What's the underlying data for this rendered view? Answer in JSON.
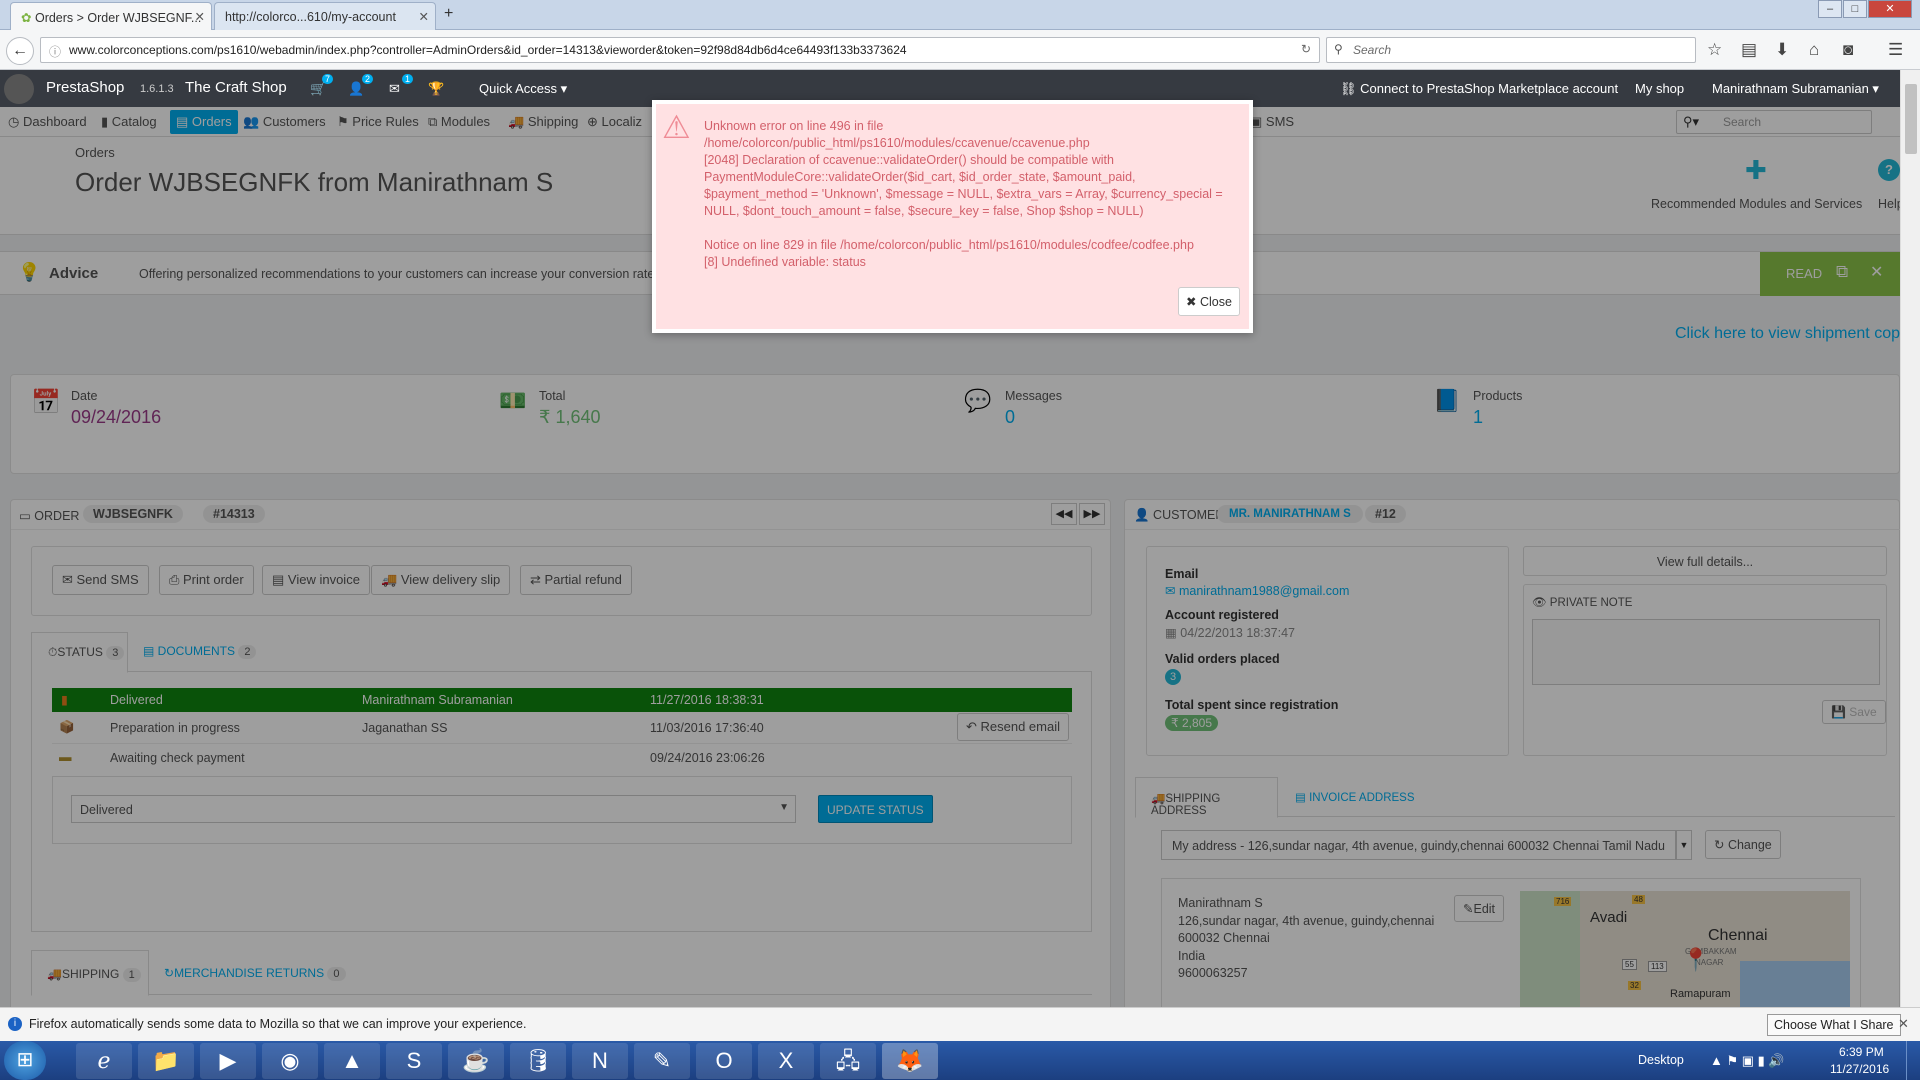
{
  "browser": {
    "tabs": [
      {
        "title": "Orders > Order WJBSEGNF...",
        "active": true
      },
      {
        "title": "http://colorco...610/my-account",
        "active": false
      }
    ],
    "url": "www.colorconceptions.com/ps1610/webadmin/index.php?controller=AdminOrders&id_order=14313&vieworder&token=92f98d84db6d4ce64493f133b3373624",
    "search_placeholder": "Search"
  },
  "header": {
    "brand": "PrestaShop",
    "version": "1.6.1.3",
    "shop_name": "The Craft Shop",
    "cart_count": "7",
    "customers_count": "2",
    "messages_count": "1",
    "quick_access": "Quick Access",
    "marketplace": "Connect to PrestaShop Marketplace account",
    "my_shop": "My shop",
    "user": "Manirathnam Subramanian"
  },
  "menu": {
    "items": [
      "Dashboard",
      "Catalog",
      "Orders",
      "Customers",
      "Price Rules",
      "Modules",
      "Shipping",
      "Localiz",
      "SMS"
    ],
    "search_placeholder": "Search"
  },
  "page": {
    "breadcrumb": "Orders",
    "title": "Order WJBSEGNFK from Manirathnam S",
    "recommended": "Recommended Modules and Services",
    "help": "Help"
  },
  "advice": {
    "label": "Advice",
    "text": "Offering personalized recommendations to your customers can increase your conversion rate",
    "read": "READ"
  },
  "shipment_link": "Click here to view shipment copy",
  "kpis": [
    {
      "label": "Date",
      "value": "09/24/2016"
    },
    {
      "label": "Total",
      "value": "₹ 1,640"
    },
    {
      "label": "Messages",
      "value": "0"
    },
    {
      "label": "Products",
      "value": "1"
    }
  ],
  "order": {
    "heading": "ORDER",
    "reference": "WJBSEGNFK",
    "id": "#14313",
    "actions": [
      "Send SMS",
      "Print order",
      "View invoice",
      "View delivery slip",
      "Partial refund"
    ],
    "tab_status": "STATUS",
    "tab_status_count": "3",
    "tab_documents": "DOCUMENTS",
    "tab_documents_count": "2",
    "history": [
      {
        "status": "Delivered",
        "employee": "Manirathnam Subramanian",
        "date": "11/27/2016 18:38:31"
      },
      {
        "status": "Preparation in progress",
        "employee": "Jaganathan SS",
        "date": "11/03/2016 17:36:40"
      },
      {
        "status": "Awaiting check payment",
        "employee": "",
        "date": "09/24/2016 23:06:26"
      }
    ],
    "resend_email": "Resend email",
    "status_select": "Delivered",
    "update_status": "UPDATE STATUS",
    "tab_shipping": "SHIPPING",
    "tab_shipping_count": "1",
    "tab_returns": "MERCHANDISE RETURNS",
    "tab_returns_count": "0"
  },
  "customer": {
    "heading": "CUSTOMER",
    "name": "MR. MANIRATHNAM S",
    "id": "#12",
    "view_details": "View full details...",
    "email_label": "Email",
    "email": "manirathnam1988@gmail.com",
    "registered_label": "Account registered",
    "registered": "04/22/2013 18:37:47",
    "valid_orders_label": "Valid orders placed",
    "valid_orders": "3",
    "total_spent_label": "Total spent since registration",
    "total_spent": "₹ 2,805",
    "private_note": "PRIVATE NOTE",
    "save": "Save",
    "tab_shipping_address": "SHIPPING ADDRESS",
    "tab_invoice_address": "INVOICE ADDRESS",
    "address_select": "My address - 126,sundar nagar, 4th avenue, guindy,chennai 600032 Chennai Tamil Nadu",
    "change": "Change",
    "edit": "Edit",
    "address_lines": [
      "Manirathnam S",
      "126,sundar nagar, 4th avenue, guindy,chennai",
      "600032 Chennai",
      "India",
      "9600063257"
    ],
    "map_labels": [
      "Avadi",
      "Chennai",
      "GAMBAKKAM",
      "NAGAR",
      "Ramapuram",
      "716",
      "48",
      "55",
      "113",
      "32"
    ]
  },
  "modal": {
    "line1": "Unknown error on line 496 in file /home/colorcon/public_html/ps1610/modules/ccavenue/ccavenue.php",
    "line2": "[2048] Declaration of ccavenue::validateOrder() should be compatible with PaymentModuleCore::validateOrder($id_cart, $id_order_state, $amount_paid, $payment_method = 'Unknown', $message = NULL, $extra_vars = Array, $currency_special = NULL, $dont_touch_amount = false, $secure_key = false, Shop $shop = NULL)",
    "line3": "Notice on line 829 in file /home/colorcon/public_html/ps1610/modules/codfee/codfee.php",
    "line4": "[8] Undefined variable: status",
    "close": "Close"
  },
  "notification": {
    "text": "Firefox automatically sends some data to Mozilla so that we can improve your experience.",
    "button": "Choose What I Share"
  },
  "taskbar": {
    "desktop": "Desktop",
    "time": "6:39 PM",
    "date": "11/27/2016"
  },
  "colors": {
    "prestashop_blue": "#00aff0",
    "header_dark": "#363a41",
    "delivered_green": "#108510",
    "error_pink": "#ffe1e3",
    "error_text": "#d3606b"
  }
}
